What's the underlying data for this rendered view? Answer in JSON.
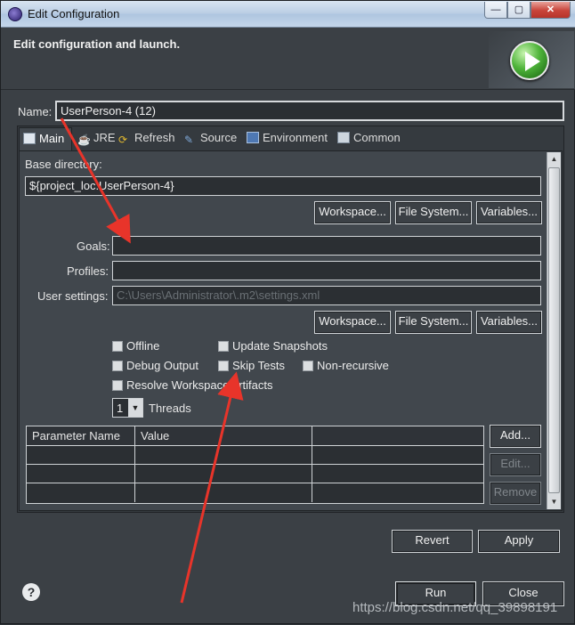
{
  "window": {
    "title": "Edit Configuration",
    "min": "—",
    "max": "▢",
    "close": "✕"
  },
  "header": {
    "heading": "Edit configuration and launch."
  },
  "name": {
    "label": "Name:",
    "value": "UserPerson-4 (12)"
  },
  "tabs": [
    {
      "label": "Main",
      "icon": "main-tab-icon"
    },
    {
      "label": "JRE",
      "icon": "jre-icon"
    },
    {
      "label": "Refresh",
      "icon": "refresh-icon"
    },
    {
      "label": "Source",
      "icon": "source-icon"
    },
    {
      "label": "Environment",
      "icon": "environment-icon"
    },
    {
      "label": "Common",
      "icon": "common-icon"
    }
  ],
  "main": {
    "base_dir_label": "Base directory:",
    "base_dir_value": "${project_loc:UserPerson-4}",
    "workspace_btn": "Workspace...",
    "filesystem_btn": "File System...",
    "variables_btn": "Variables...",
    "goals_label": "Goals:",
    "goals_value": "",
    "profiles_label": "Profiles:",
    "profiles_value": "",
    "user_settings_label": "User settings:",
    "user_settings_placeholder": "C:\\Users\\Administrator\\.m2\\settings.xml",
    "checkboxes": {
      "offline": "Offline",
      "update_snapshots": "Update Snapshots",
      "debug_output": "Debug Output",
      "skip_tests": "Skip Tests",
      "non_recursive": "Non-recursive",
      "resolve_workspace": "Resolve Workspace artifacts"
    },
    "threads_value": "1",
    "threads_label": "Threads",
    "table": {
      "headers": [
        "Parameter Name",
        "Value",
        ""
      ]
    },
    "add_btn": "Add...",
    "edit_btn": "Edit...",
    "remove_btn": "Remove"
  },
  "footer": {
    "revert_btn": "Revert",
    "apply_btn": "Apply",
    "run_btn": "Run",
    "close_btn": "Close",
    "help": "?"
  },
  "watermark": "https://blog.csdn.net/qq_39898191",
  "colors": {
    "accent_arrow": "#e8342a",
    "panel": "#41474d"
  }
}
